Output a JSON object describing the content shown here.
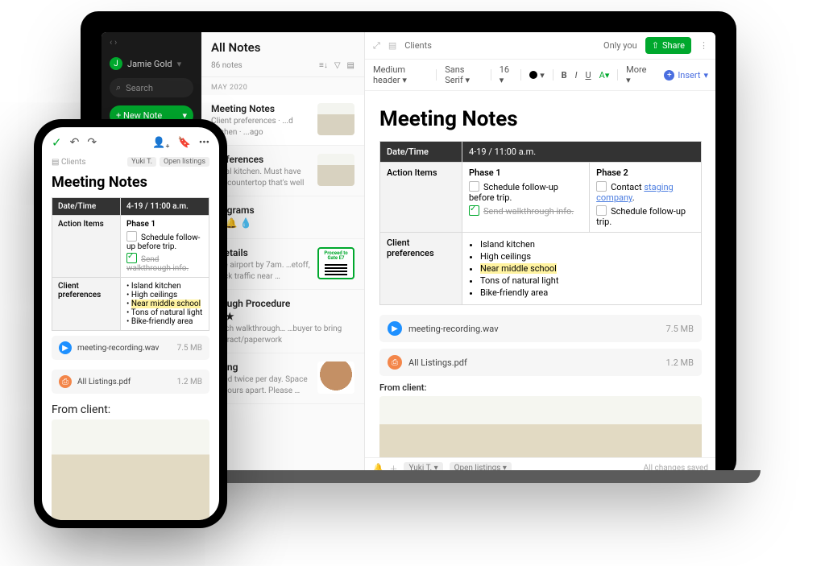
{
  "sidebar": {
    "user_name": "Jamie Gold",
    "user_initial": "J",
    "search_placeholder": "Search",
    "new_note_label": "+ New Note"
  },
  "note_list": {
    "title": "All Notes",
    "count_label": "86 notes",
    "section_label": "MAY 2020",
    "items": [
      {
        "title": "Meeting Notes",
        "subtitle": "Client preferences · ...d kitchen · ...ago"
      },
      {
        "title": "Preferences",
        "subtitle": "…deal kitchen. Must have an …countertop that's well …"
      },
      {
        "title": "…rograms",
        "subtitle": "",
        "icons": "⭐ 🔔 💧"
      },
      {
        "title": "…Details",
        "subtitle": "…the airport by 7am. …etoff, check traffic near …",
        "qr_label": "Proceed to Gate E7"
      },
      {
        "title": "…rough Procedure",
        "subtitle": "…each walkthrough… …buyer to bring contract/paperwork",
        "icons": "⭐ ★"
      },
      {
        "title": "…tting",
        "subtitle": "…feed twice per day. Space …2 hours apart. Please …"
      }
    ]
  },
  "editor": {
    "crumb_icon": "📄",
    "crumb_label": "Clients",
    "only_you": "Only you",
    "share_label": "Share",
    "format": {
      "style": "Medium header",
      "font": "Sans Serif",
      "size": "16",
      "b": "B",
      "i": "I",
      "u": "U",
      "hl": "A",
      "more": "More",
      "insert": "Insert"
    },
    "title": "Meeting Notes",
    "table": {
      "h1": "Date/Time",
      "h1v": "4-19 / 11:00 a.m.",
      "r1": "Action Items",
      "phase1": "Phase 1",
      "phase2": "Phase 2",
      "p1_item1": "Schedule follow-up before trip.",
      "p1_item2": "Send walkthrough info.",
      "p2_item1": "Contact ",
      "p2_link": "staging company",
      "p2_item2": "Schedule follow-up trip.",
      "r2": "Client preferences",
      "prefs": [
        "Island kitchen",
        "High ceilings",
        "Near middle school",
        "Tons of natural light",
        "Bike-friendly area"
      ]
    },
    "attach1": {
      "name": "meeting-recording.wav",
      "size": "7.5 MB"
    },
    "attach2": {
      "name": "All Listings.pdf",
      "size": "1.2 MB"
    },
    "from_client": "From client:",
    "footer": {
      "shared": "Yuki T.",
      "tag": "Open listings",
      "saved": "All changes saved"
    }
  },
  "phone": {
    "crumb": "Clients",
    "chip1": "Yuki T.",
    "chip2": "Open listings",
    "title": "Meeting Notes",
    "from_client": "From client:"
  }
}
